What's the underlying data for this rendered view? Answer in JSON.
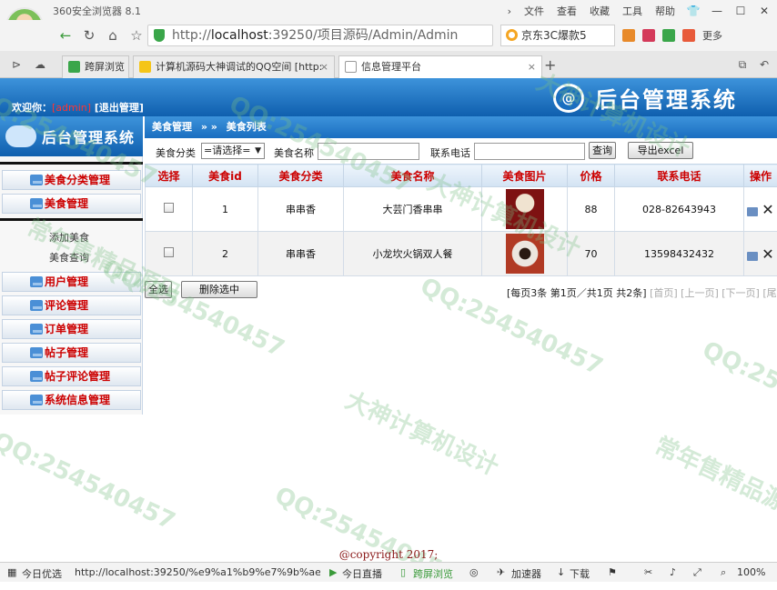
{
  "browser": {
    "title": "360安全浏览器 8.1",
    "menu": [
      "文件",
      "查看",
      "收藏",
      "工具",
      "帮助"
    ],
    "url_scheme": "http://",
    "url_host": "localhost",
    "url_rest": ":39250/项目源码/Admin/Admin",
    "search_text": "京东3C爆款5",
    "more_label": "更多",
    "tabs": [
      {
        "label": "跨屏浏览",
        "icon": "screen-icon"
      },
      {
        "label": "计算机源码大神调试的QQ空间 [http:",
        "icon": "star-icon"
      },
      {
        "label": "信息管理平台",
        "icon": "page-icon"
      }
    ]
  },
  "header": {
    "welcome_prefix": "欢迎你：",
    "username": "[admin]",
    "logout": "[退出管理]",
    "system_title": "后台管理系统",
    "logo_text": "@"
  },
  "sidebar": {
    "title": "后台管理系统",
    "items": [
      {
        "label": "美食分类管理"
      },
      {
        "label": "美食管理"
      }
    ],
    "sub_items": [
      {
        "label": "添加美食"
      },
      {
        "label": "美食查询"
      }
    ],
    "more_items": [
      {
        "label": "用户管理"
      },
      {
        "label": "评论管理"
      },
      {
        "label": "订单管理"
      },
      {
        "label": "帖子管理"
      },
      {
        "label": "帖子评论管理"
      },
      {
        "label": "系统信息管理"
      }
    ]
  },
  "breadcrumb": {
    "section": "美食管理",
    "separator": "» »",
    "page": "美食列表"
  },
  "search": {
    "category_label": "美食分类",
    "category_value": "=请选择=",
    "name_label": "美食名称",
    "phone_label": "联系电话",
    "query_button": "查询",
    "export_button": "导出excel"
  },
  "table": {
    "headers": [
      "选择",
      "美食id",
      "美食分类",
      "美食名称",
      "美食图片",
      "价格",
      "联系电话",
      "操作"
    ],
    "rows": [
      {
        "id": "1",
        "category": "串串香",
        "name": "大芸门香串串",
        "price": "88",
        "phone": "028-82643943"
      },
      {
        "id": "2",
        "category": "串串香",
        "name": "小龙坎火锅双人餐",
        "price": "70",
        "phone": "13598432432"
      }
    ]
  },
  "pager": {
    "select_all": "全选",
    "delete_selected": "删除选中",
    "info": "[每页3条 第1页／共1页 共2条]",
    "first": "[首页]",
    "prev": "[上一页]",
    "next": "[下一页]",
    "last": "[尾页]"
  },
  "footer": {
    "copyright": "@copyright 2017;"
  },
  "watermarks": [
    "QQ:254540457",
    "大神计算机设计",
    "常年售精品源码"
  ],
  "statusbar": {
    "left_label": "今日优选",
    "hover_url": "http://localhost:39250/%e9%a1%b9%e7%9b%ae%e6",
    "live_label": "今日直播",
    "screen_label": "跨屏浏览",
    "speed_label": "加速器",
    "download_label": "下载",
    "zoom": "100%"
  },
  "colors": {
    "header_blue": "#1a6ec0",
    "sidebar_text": "#cc0000",
    "footer_text": "#8b1a1a"
  }
}
